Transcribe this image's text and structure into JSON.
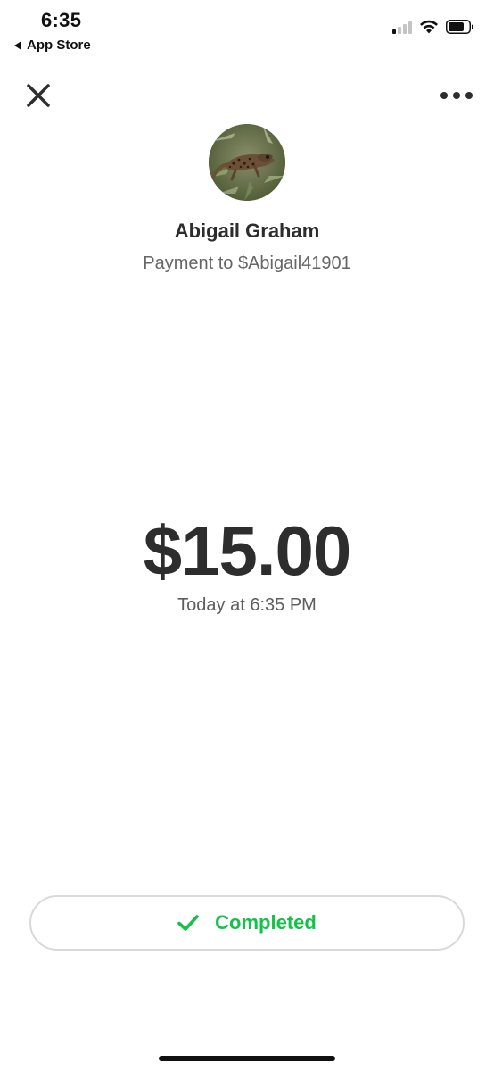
{
  "status_bar": {
    "time": "6:35",
    "back_app": "App Store",
    "signal_bars_active": 1,
    "signal_bars_total": 4
  },
  "header": {
    "close_icon": "close-icon",
    "more_icon": "more-horizontal-icon"
  },
  "recipient": {
    "name": "Abigail Graham",
    "subtitle": "Payment to $Abigail41901",
    "avatar": "lizard-photo"
  },
  "payment": {
    "amount": "$15.00",
    "timestamp": "Today at 6:35 PM"
  },
  "status": {
    "label": "Completed",
    "icon": "checkmark-icon",
    "color": "#14c24a"
  }
}
